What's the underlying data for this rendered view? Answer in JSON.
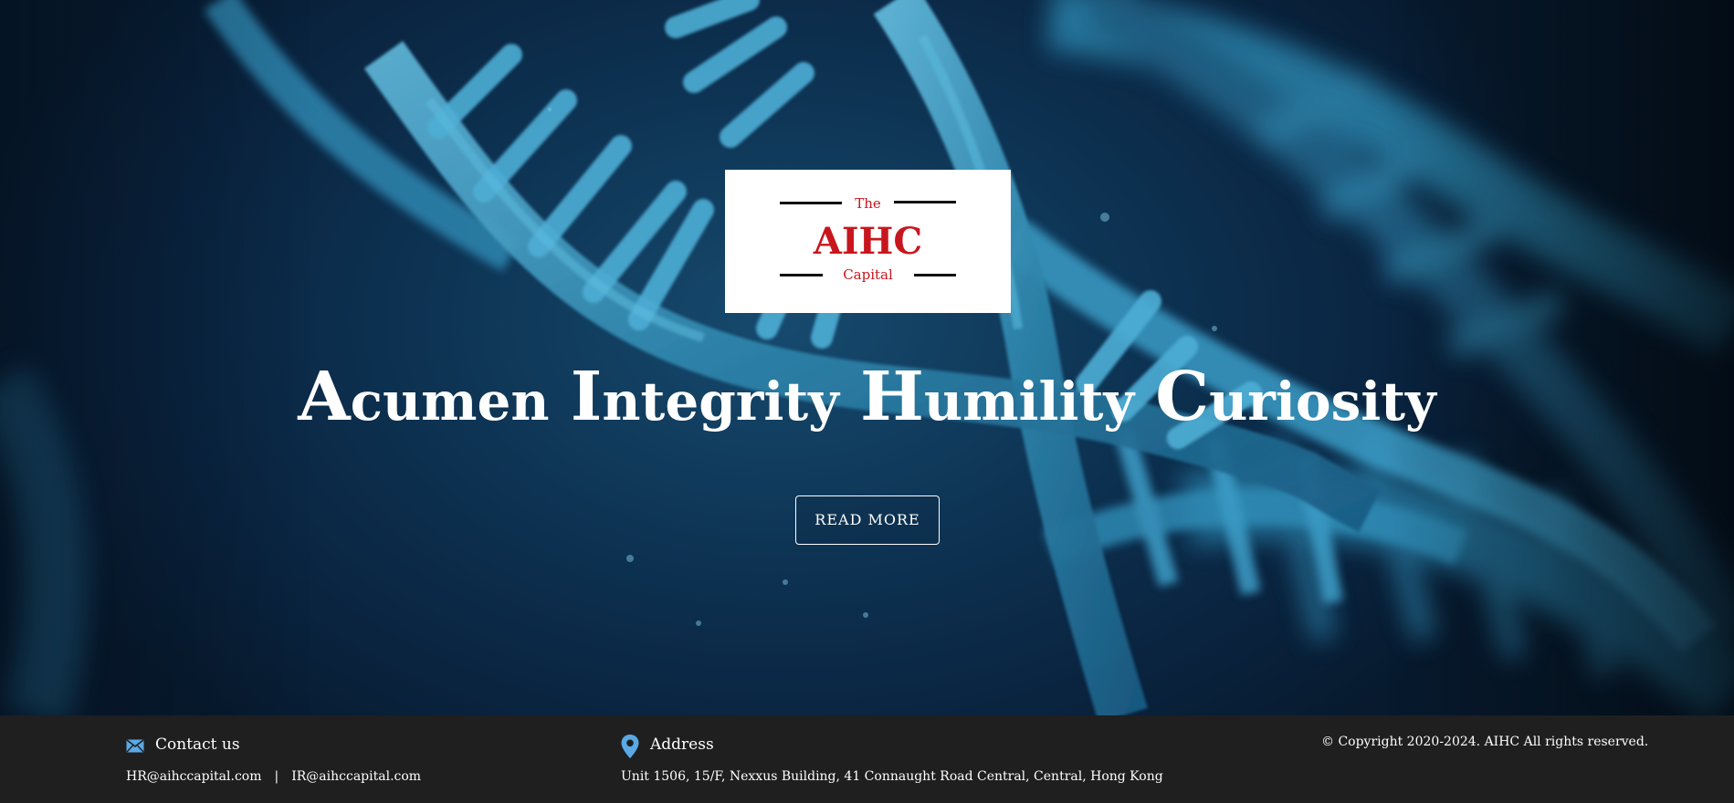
{
  "hero": {
    "logo": {
      "top": "The",
      "name": "AIHC",
      "bottom": "Capital"
    },
    "tagline": [
      {
        "initial": "A",
        "rest": "cumen"
      },
      {
        "initial": "I",
        "rest": "ntegrity"
      },
      {
        "initial": "H",
        "rest": "umility"
      },
      {
        "initial": "C",
        "rest": "uriosity"
      }
    ],
    "button_label": "READ MORE"
  },
  "footer": {
    "contact": {
      "title": "Contact us",
      "icon": "envelope-icon",
      "email_hr": "HR@aihccapital.com",
      "separator": "|",
      "email_ir": "IR@aihccapital.com"
    },
    "address": {
      "title": "Address",
      "icon": "map-pin-icon",
      "text": "Unit 1506, 15/F, Nexxus Building, 41 Connaught Road Central, Central, Hong Kong"
    },
    "copyright": "© Copyright 2020-2024. AIHC All rights reserved."
  },
  "colors": {
    "brand_red": "#c8161d",
    "footer_bg": "#1f1f1f",
    "icon_blue": "#5aa9e6"
  }
}
